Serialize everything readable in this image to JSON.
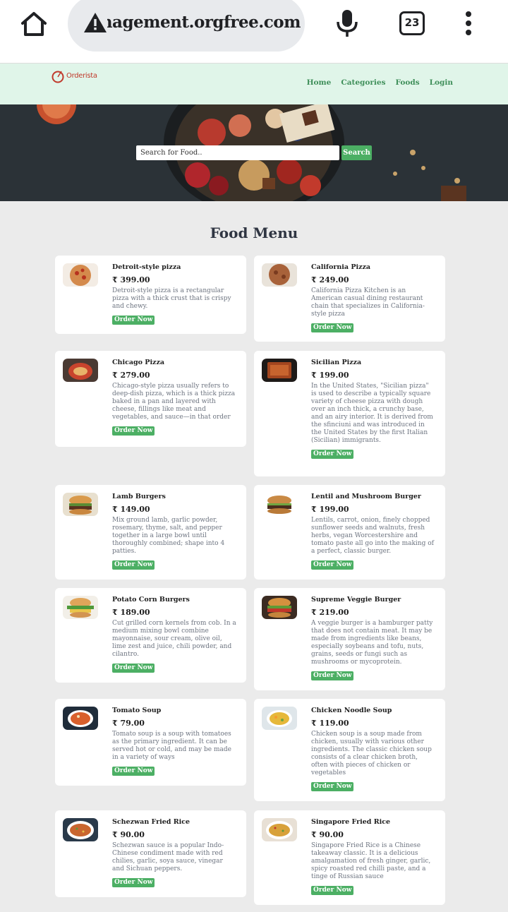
{
  "browser": {
    "url": "xyz-food-management.orgfree.com",
    "tab_count": "23"
  },
  "nav": {
    "logo_text": "Orderista",
    "links": [
      "Home",
      "Categories",
      "Foods",
      "Login"
    ]
  },
  "search": {
    "placeholder": "Search for Food..",
    "button_label": "Search"
  },
  "menu": {
    "title": "Food Menu",
    "order_label": "Order Now",
    "items": [
      {
        "name": "Detroit-style pizza",
        "price": "₹ 399.00",
        "description": "Detroit-style pizza is a rectangular pizza with a thick crust that is crispy and chewy.",
        "image": "pizza-detroit"
      },
      {
        "name": "California Pizza",
        "price": "₹ 249.00",
        "description": "California Pizza Kitchen is an American casual dining restaurant chain that specializes in California-style pizza",
        "image": "pizza-california"
      },
      {
        "name": "Chicago Pizza",
        "price": "₹ 279.00",
        "description": "Chicago-style pizza usually refers to deep-dish pizza, which is a thick pizza baked in a pan and layered with cheese, fillings like meat and vegetables, and sauce—in that order",
        "image": "pizza-chicago"
      },
      {
        "name": "Sicilian Pizza",
        "price": "₹ 199.00",
        "description": "In the United States, \"Sicilian pizza\" is used to describe a typically square variety of cheese pizza with dough over an inch thick, a crunchy base, and an airy interior. It is derived from the sfinciuni and was introduced in the United States by the first Italian (Sicilian) immigrants.",
        "image": "pizza-sicilian"
      },
      {
        "name": "Lamb Burgers",
        "price": "₹ 149.00",
        "description": "Mix ground lamb, garlic powder, rosemary, thyme, salt, and pepper together in a large bowl until thoroughly combined; shape into 4 patties.",
        "image": "burger-lamb"
      },
      {
        "name": "Lentil and Mushroom Burger",
        "price": "₹ 199.00",
        "description": "Lentils, carrot, onion, finely chopped sunflower seeds and walnuts, fresh herbs, vegan Worcestershire and tomato paste all go into the making of a perfect, classic burger.",
        "image": "burger-lentil"
      },
      {
        "name": "Potato Corn Burgers",
        "price": "₹ 189.00",
        "description": "Cut grilled corn kernels from cob. In a medium mixing bowl combine mayonnaise, sour cream, olive oil, lime zest and juice, chili powder, and cilantro.",
        "image": "burger-potato-corn"
      },
      {
        "name": "Supreme Veggie Burger",
        "price": "₹ 219.00",
        "description": "A veggie burger is a hamburger patty that does not contain meat. It may be made from ingredients like beans, especially soybeans and tofu, nuts, grains, seeds or fungi such as mushrooms or mycoprotein.",
        "image": "burger-veggie"
      },
      {
        "name": "Tomato Soup",
        "price": "₹ 79.00",
        "description": "Tomato soup is a soup with tomatoes as the primary ingredient. It can be served hot or cold, and may be made in a variety of ways",
        "image": "soup-tomato"
      },
      {
        "name": "Chicken Noodle Soup",
        "price": "₹ 119.00",
        "description": "Chicken soup is a soup made from chicken, usually with various other ingredients. The classic chicken soup consists of a clear chicken broth, often with pieces of chicken or vegetables",
        "image": "soup-chicken-noodle"
      },
      {
        "name": "Schezwan Fried Rice",
        "price": "₹ 90.00",
        "description": "Schezwan sauce is a popular Indo-Chinese condiment made with red chilies, garlic, soya sauce, vinegar and Sichuan peppers.",
        "image": "rice-schezwan"
      },
      {
        "name": "Singapore Fried Rice",
        "price": "₹ 90.00",
        "description": "Singapore Fried Rice is a Chinese takeaway classic. It is a delicious amalgamation of fresh ginger, garlic, spicy roasted red chilli paste, and a tinge of Russian sauce",
        "image": "rice-singapore"
      }
    ]
  },
  "colors": {
    "accent_green": "#4caf64",
    "nav_bg": "#e0f5e9",
    "nav_link": "#3f8f5a",
    "page_bg": "#ebebeb"
  }
}
